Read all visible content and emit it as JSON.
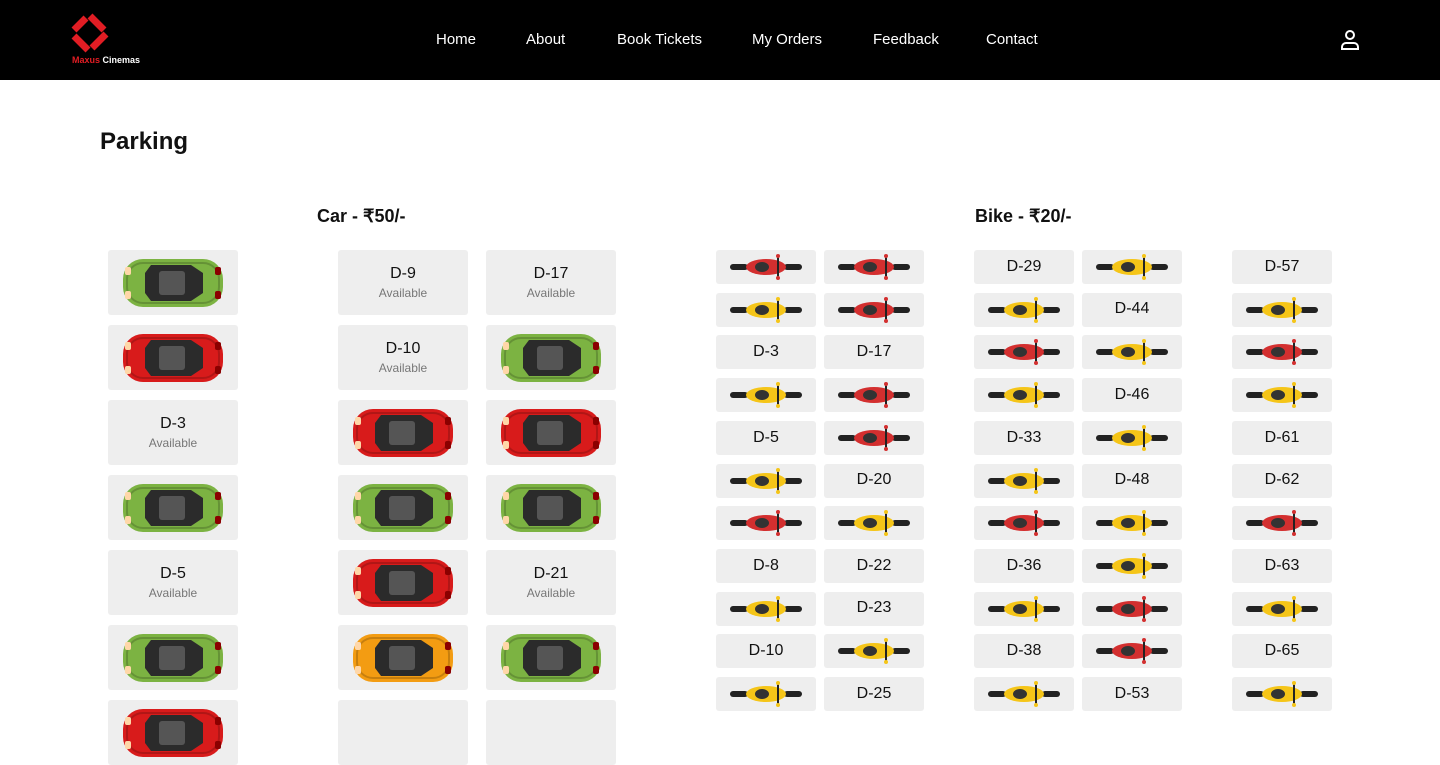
{
  "brand": {
    "name_part1": "Maxus",
    "name_part2": " Cinemas"
  },
  "nav": [
    "Home",
    "About",
    "Book Tickets",
    "My Orders",
    "Feedback",
    "Contact"
  ],
  "page_title": "Parking",
  "car_section": {
    "title": "Car - ₹50/-",
    "status_label": "Available",
    "columns": [
      [
        {
          "car": "green"
        },
        {
          "car": "red"
        },
        {
          "label": "D-3"
        },
        {
          "car": "green"
        },
        {
          "label": "D-5"
        },
        {
          "car": "green"
        },
        {
          "car": "red"
        }
      ],
      [
        {
          "label": "D-9"
        },
        {
          "label": "D-10"
        },
        {
          "car": "red"
        },
        {
          "car": "green"
        },
        {
          "car": "red"
        },
        {
          "car": "orange"
        },
        {
          "label": ""
        }
      ],
      [
        {
          "label": "D-17"
        },
        {
          "car": "green"
        },
        {
          "car": "red"
        },
        {
          "car": "green"
        },
        {
          "label": "D-21"
        },
        {
          "car": "green"
        },
        {
          "label": ""
        }
      ]
    ]
  },
  "bike_section": {
    "title": "Bike - ₹20/-",
    "columns": [
      [
        {
          "bike": "red"
        },
        {
          "bike": "yellow"
        },
        {
          "label": "D-3"
        },
        {
          "bike": "yellow"
        },
        {
          "label": "D-5"
        },
        {
          "bike": "yellow"
        },
        {
          "bike": "red"
        },
        {
          "label": "D-8"
        },
        {
          "bike": "yellow"
        },
        {
          "label": "D-10"
        },
        {
          "bike": "yellow"
        }
      ],
      [
        {
          "bike": "red"
        },
        {
          "bike": "red"
        },
        {
          "label": "D-17"
        },
        {
          "bike": "red"
        },
        {
          "bike": "red"
        },
        {
          "label": "D-20"
        },
        {
          "bike": "yellow"
        },
        {
          "label": "D-22"
        },
        {
          "label": "D-23"
        },
        {
          "bike": "yellow"
        },
        {
          "label": "D-25"
        }
      ],
      [
        {
          "label": "D-29"
        },
        {
          "bike": "yellow"
        },
        {
          "bike": "red"
        },
        {
          "bike": "yellow"
        },
        {
          "label": "D-33"
        },
        {
          "bike": "yellow"
        },
        {
          "bike": "red"
        },
        {
          "label": "D-36"
        },
        {
          "bike": "yellow"
        },
        {
          "label": "D-38"
        },
        {
          "bike": "yellow"
        }
      ],
      [
        {
          "bike": "yellow"
        },
        {
          "label": "D-44"
        },
        {
          "bike": "yellow"
        },
        {
          "label": "D-46"
        },
        {
          "bike": "yellow"
        },
        {
          "label": "D-48"
        },
        {
          "bike": "yellow"
        },
        {
          "bike": "yellow"
        },
        {
          "bike": "red"
        },
        {
          "bike": "red"
        },
        {
          "label": "D-53"
        }
      ],
      [
        {
          "label": "D-57"
        },
        {
          "bike": "yellow"
        },
        {
          "bike": "red"
        },
        {
          "bike": "yellow"
        },
        {
          "label": "D-61"
        },
        {
          "label": "D-62"
        },
        {
          "bike": "red"
        },
        {
          "label": "D-63"
        },
        {
          "bike": "yellow"
        },
        {
          "label": "D-65"
        },
        {
          "bike": "yellow"
        }
      ]
    ]
  },
  "colors": {
    "navbar": "#000000",
    "accent": "#e11d24",
    "slot_bg": "#eeeeee",
    "car_green": "#7cb342",
    "car_red": "#d81b1b",
    "car_orange": "#f39c12",
    "bike_red": "#d32f2f",
    "bike_yellow": "#f5c518"
  }
}
